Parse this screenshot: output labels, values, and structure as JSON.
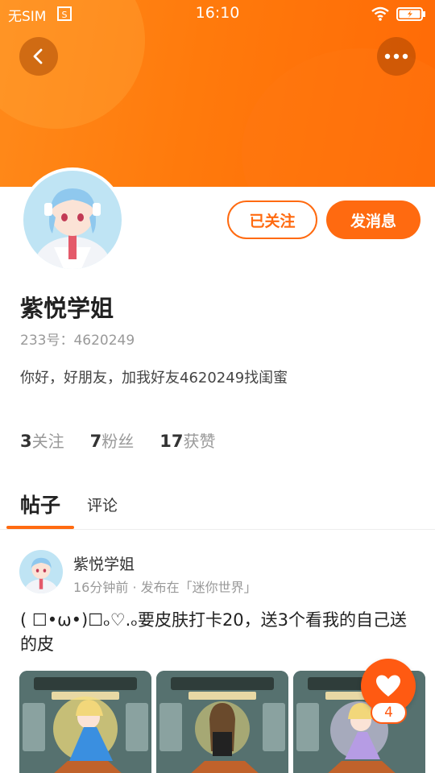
{
  "status_bar": {
    "carrier": "无SIM",
    "time": "16:10"
  },
  "profile": {
    "name": "紫悦学姐",
    "id_line": "233号：4620249",
    "bio": "你好，好朋友，加我好友4620249找闺蜜",
    "follow_button": "已关注",
    "message_button": "发消息"
  },
  "stats": [
    {
      "value": "3",
      "label": "关注"
    },
    {
      "value": "7",
      "label": "粉丝"
    },
    {
      "value": "17",
      "label": "获赞"
    }
  ],
  "tabs": {
    "posts": "帖子",
    "comments": "评论"
  },
  "post": {
    "author": "紫悦学姐",
    "meta": "16分钟前 · 发布在「迷你世界」",
    "text": "( ☐•ω•)☐ₒ♡.ₒ要皮肤打卡20，送3个看我的自己送的皮",
    "like_count": "4"
  },
  "colors": {
    "accent": "#ff6a10",
    "header": "#ff7a0c"
  },
  "icons": {
    "back": "chevron-left-icon",
    "more": "more-dots-icon",
    "like": "heart-icon"
  }
}
